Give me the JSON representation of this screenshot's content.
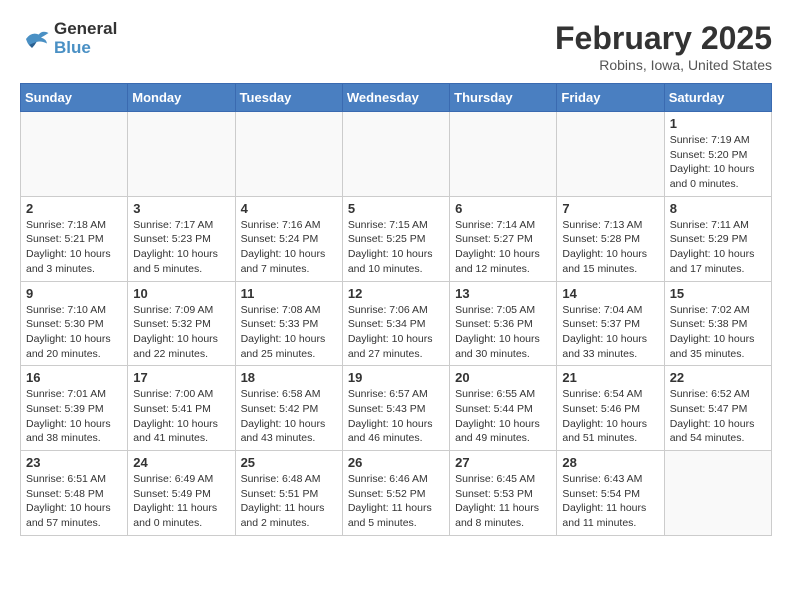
{
  "header": {
    "logo_line1": "General",
    "logo_line2": "Blue",
    "month": "February 2025",
    "location": "Robins, Iowa, United States"
  },
  "weekdays": [
    "Sunday",
    "Monday",
    "Tuesday",
    "Wednesday",
    "Thursday",
    "Friday",
    "Saturday"
  ],
  "weeks": [
    [
      {
        "day": "",
        "info": ""
      },
      {
        "day": "",
        "info": ""
      },
      {
        "day": "",
        "info": ""
      },
      {
        "day": "",
        "info": ""
      },
      {
        "day": "",
        "info": ""
      },
      {
        "day": "",
        "info": ""
      },
      {
        "day": "1",
        "info": "Sunrise: 7:19 AM\nSunset: 5:20 PM\nDaylight: 10 hours\nand 0 minutes."
      }
    ],
    [
      {
        "day": "2",
        "info": "Sunrise: 7:18 AM\nSunset: 5:21 PM\nDaylight: 10 hours\nand 3 minutes."
      },
      {
        "day": "3",
        "info": "Sunrise: 7:17 AM\nSunset: 5:23 PM\nDaylight: 10 hours\nand 5 minutes."
      },
      {
        "day": "4",
        "info": "Sunrise: 7:16 AM\nSunset: 5:24 PM\nDaylight: 10 hours\nand 7 minutes."
      },
      {
        "day": "5",
        "info": "Sunrise: 7:15 AM\nSunset: 5:25 PM\nDaylight: 10 hours\nand 10 minutes."
      },
      {
        "day": "6",
        "info": "Sunrise: 7:14 AM\nSunset: 5:27 PM\nDaylight: 10 hours\nand 12 minutes."
      },
      {
        "day": "7",
        "info": "Sunrise: 7:13 AM\nSunset: 5:28 PM\nDaylight: 10 hours\nand 15 minutes."
      },
      {
        "day": "8",
        "info": "Sunrise: 7:11 AM\nSunset: 5:29 PM\nDaylight: 10 hours\nand 17 minutes."
      }
    ],
    [
      {
        "day": "9",
        "info": "Sunrise: 7:10 AM\nSunset: 5:30 PM\nDaylight: 10 hours\nand 20 minutes."
      },
      {
        "day": "10",
        "info": "Sunrise: 7:09 AM\nSunset: 5:32 PM\nDaylight: 10 hours\nand 22 minutes."
      },
      {
        "day": "11",
        "info": "Sunrise: 7:08 AM\nSunset: 5:33 PM\nDaylight: 10 hours\nand 25 minutes."
      },
      {
        "day": "12",
        "info": "Sunrise: 7:06 AM\nSunset: 5:34 PM\nDaylight: 10 hours\nand 27 minutes."
      },
      {
        "day": "13",
        "info": "Sunrise: 7:05 AM\nSunset: 5:36 PM\nDaylight: 10 hours\nand 30 minutes."
      },
      {
        "day": "14",
        "info": "Sunrise: 7:04 AM\nSunset: 5:37 PM\nDaylight: 10 hours\nand 33 minutes."
      },
      {
        "day": "15",
        "info": "Sunrise: 7:02 AM\nSunset: 5:38 PM\nDaylight: 10 hours\nand 35 minutes."
      }
    ],
    [
      {
        "day": "16",
        "info": "Sunrise: 7:01 AM\nSunset: 5:39 PM\nDaylight: 10 hours\nand 38 minutes."
      },
      {
        "day": "17",
        "info": "Sunrise: 7:00 AM\nSunset: 5:41 PM\nDaylight: 10 hours\nand 41 minutes."
      },
      {
        "day": "18",
        "info": "Sunrise: 6:58 AM\nSunset: 5:42 PM\nDaylight: 10 hours\nand 43 minutes."
      },
      {
        "day": "19",
        "info": "Sunrise: 6:57 AM\nSunset: 5:43 PM\nDaylight: 10 hours\nand 46 minutes."
      },
      {
        "day": "20",
        "info": "Sunrise: 6:55 AM\nSunset: 5:44 PM\nDaylight: 10 hours\nand 49 minutes."
      },
      {
        "day": "21",
        "info": "Sunrise: 6:54 AM\nSunset: 5:46 PM\nDaylight: 10 hours\nand 51 minutes."
      },
      {
        "day": "22",
        "info": "Sunrise: 6:52 AM\nSunset: 5:47 PM\nDaylight: 10 hours\nand 54 minutes."
      }
    ],
    [
      {
        "day": "23",
        "info": "Sunrise: 6:51 AM\nSunset: 5:48 PM\nDaylight: 10 hours\nand 57 minutes."
      },
      {
        "day": "24",
        "info": "Sunrise: 6:49 AM\nSunset: 5:49 PM\nDaylight: 11 hours\nand 0 minutes."
      },
      {
        "day": "25",
        "info": "Sunrise: 6:48 AM\nSunset: 5:51 PM\nDaylight: 11 hours\nand 2 minutes."
      },
      {
        "day": "26",
        "info": "Sunrise: 6:46 AM\nSunset: 5:52 PM\nDaylight: 11 hours\nand 5 minutes."
      },
      {
        "day": "27",
        "info": "Sunrise: 6:45 AM\nSunset: 5:53 PM\nDaylight: 11 hours\nand 8 minutes."
      },
      {
        "day": "28",
        "info": "Sunrise: 6:43 AM\nSunset: 5:54 PM\nDaylight: 11 hours\nand 11 minutes."
      },
      {
        "day": "",
        "info": ""
      }
    ]
  ]
}
